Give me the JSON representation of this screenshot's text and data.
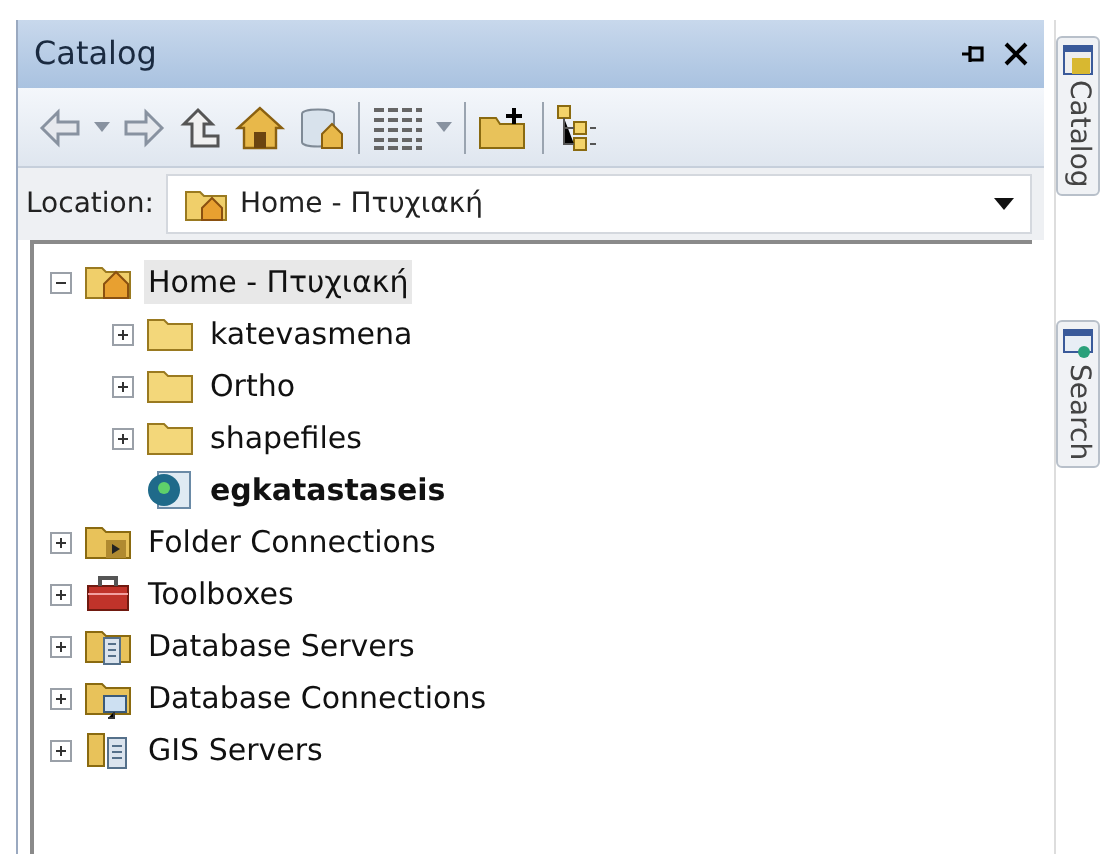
{
  "panel": {
    "title": "Catalog"
  },
  "location": {
    "label": "Location:",
    "value": "Home - Πτυχιακή"
  },
  "tree": [
    {
      "label": "Home - Πτυχιακή",
      "kind": "home",
      "expanded": true,
      "selected": true,
      "children": [
        {
          "label": "katevasmena",
          "kind": "folder",
          "expanded": false,
          "selected": false
        },
        {
          "label": "Ortho",
          "kind": "folder",
          "expanded": false,
          "selected": false
        },
        {
          "label": "shapefiles",
          "kind": "folder",
          "expanded": false,
          "selected": false
        },
        {
          "label": "egkatastaseis",
          "kind": "map",
          "selected": false
        }
      ]
    },
    {
      "label": "Folder Connections",
      "kind": "connections",
      "expanded": false,
      "selected": false
    },
    {
      "label": "Toolboxes",
      "kind": "toolbox",
      "expanded": false,
      "selected": false
    },
    {
      "label": "Database Servers",
      "kind": "dbserver",
      "expanded": false,
      "selected": false
    },
    {
      "label": "Database Connections",
      "kind": "dbconn",
      "expanded": false,
      "selected": false
    },
    {
      "label": "GIS Servers",
      "kind": "gisserver",
      "expanded": false,
      "selected": false
    }
  ],
  "side_tabs": [
    {
      "label": "Catalog",
      "kind": "catalog"
    },
    {
      "label": "Search",
      "kind": "search"
    }
  ]
}
